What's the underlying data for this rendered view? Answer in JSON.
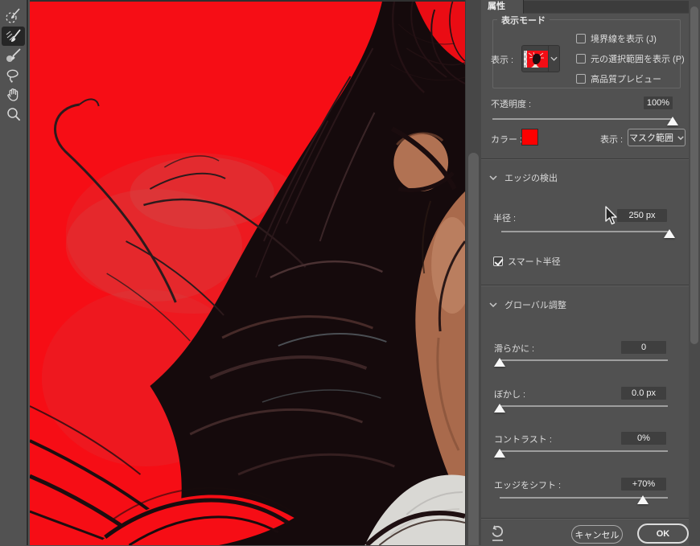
{
  "toolbar": {
    "tools": [
      {
        "name": "quick-selection-tool",
        "selected": false
      },
      {
        "name": "refine-edge-brush-tool",
        "selected": true
      },
      {
        "name": "brush-tool",
        "selected": false
      },
      {
        "name": "lasso-tool",
        "selected": false
      },
      {
        "name": "hand-tool",
        "selected": false
      },
      {
        "name": "zoom-tool",
        "selected": false
      }
    ]
  },
  "canvas": {
    "overlay_color": "#f60d15"
  },
  "panel": {
    "tab_label": "属性",
    "view_mode": {
      "legend": "表示モード",
      "view_label": "表示 :",
      "view_dropdown_icon": "overlay-view-thumbnail",
      "checkboxes": [
        {
          "label": "境界線を表示 (J)",
          "checked": false
        },
        {
          "label": "元の選択範囲を表示 (P)",
          "checked": false
        },
        {
          "label": "高品質プレビュー",
          "checked": false
        }
      ]
    },
    "opacity": {
      "label": "不透明度 :",
      "value": "100%",
      "pos": 100
    },
    "color_row": {
      "label": "カラー :",
      "swatch_color": "#fe0000",
      "view_label": "表示 :",
      "view_value": "マスク範囲"
    },
    "edge_detection": {
      "title": "エッジの検出",
      "radius": {
        "label": "半径 :",
        "value": "250 px",
        "pos": 100
      },
      "smart_radius": {
        "label": "スマート半径",
        "checked": true
      }
    },
    "global_refine": {
      "title": "グローバル調整",
      "sliders": [
        {
          "label": "滑らかに :",
          "value": "0",
          "pos": 0
        },
        {
          "label": "ぼかし :",
          "value": "0.0 px",
          "pos": 0
        },
        {
          "label": "コントラスト :",
          "value": "0%",
          "pos": 0
        },
        {
          "label": "エッジをシフト :",
          "value": "+70%",
          "pos": 85
        }
      ]
    },
    "footer": {
      "cancel_label": "キャンセル",
      "ok_label": "OK"
    }
  },
  "colors": {
    "panel_bg": "#515151",
    "accent_red": "#fe0000"
  }
}
